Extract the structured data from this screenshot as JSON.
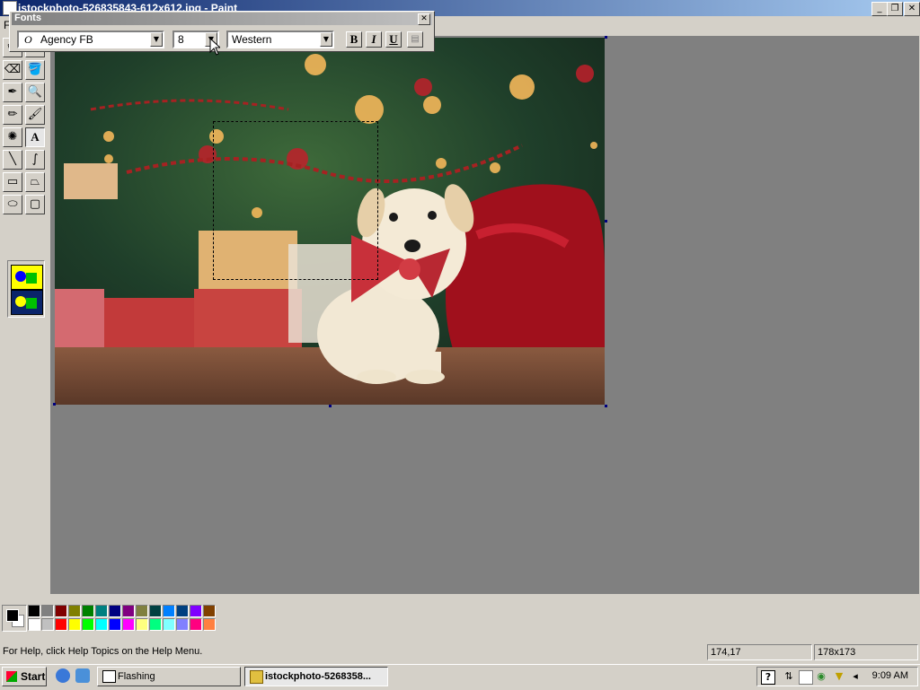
{
  "window": {
    "title": "istockphoto-526835843-612x612.jpg - Paint",
    "min_label": "_",
    "restore_label": "❐",
    "close_label": "✕"
  },
  "menu": {
    "first_letter": "F"
  },
  "fonts_toolbar": {
    "title": "Fonts",
    "font_name": "Agency FB",
    "font_glyph": "O",
    "font_size": "8",
    "script": "Western",
    "bold_label": "B",
    "italic_label": "I",
    "underline_label": "U",
    "close_label": "✕"
  },
  "tools": [
    {
      "name": "free-select-tool",
      "glyph": "⬠"
    },
    {
      "name": "rect-select-tool",
      "glyph": "⬚"
    },
    {
      "name": "eraser-tool",
      "glyph": "⌫"
    },
    {
      "name": "fill-tool",
      "glyph": "🪣"
    },
    {
      "name": "color-picker-tool",
      "glyph": "✒"
    },
    {
      "name": "magnifier-tool",
      "glyph": "🔍"
    },
    {
      "name": "pencil-tool",
      "glyph": "✏"
    },
    {
      "name": "brush-tool",
      "glyph": "🖌"
    },
    {
      "name": "airbrush-tool",
      "glyph": "✺"
    },
    {
      "name": "text-tool",
      "glyph": "A"
    },
    {
      "name": "line-tool",
      "glyph": "╲"
    },
    {
      "name": "curve-tool",
      "glyph": "∫"
    },
    {
      "name": "rectangle-tool",
      "glyph": "▭"
    },
    {
      "name": "polygon-tool",
      "glyph": "⏢"
    },
    {
      "name": "ellipse-tool",
      "glyph": "⬭"
    },
    {
      "name": "rounded-rect-tool",
      "glyph": "▢"
    }
  ],
  "palette": {
    "foreground": "#000000",
    "background": "#ffffff",
    "row1": [
      "#000000",
      "#808080",
      "#800000",
      "#808000",
      "#008000",
      "#008080",
      "#000080",
      "#800080",
      "#808040",
      "#004040",
      "#0080ff",
      "#004080",
      "#8000ff",
      "#804000"
    ],
    "row2": [
      "#ffffff",
      "#c0c0c0",
      "#ff0000",
      "#ffff00",
      "#00ff00",
      "#00ffff",
      "#0000ff",
      "#ff00ff",
      "#ffff80",
      "#00ff80",
      "#80ffff",
      "#8080ff",
      "#ff0080",
      "#ff8040"
    ]
  },
  "status": {
    "help": "For Help, click Help Topics on the Help Menu.",
    "coords": "174,17",
    "size": "178x173"
  },
  "taskbar": {
    "start": "Start",
    "tasks": [
      "Flashing",
      "istockphoto-5268358..."
    ],
    "clock": "9:09 AM",
    "tray_icons": [
      "help-icon",
      "volume-icon",
      "network-icon",
      "security-shield-icon",
      "speaker-icon"
    ]
  }
}
